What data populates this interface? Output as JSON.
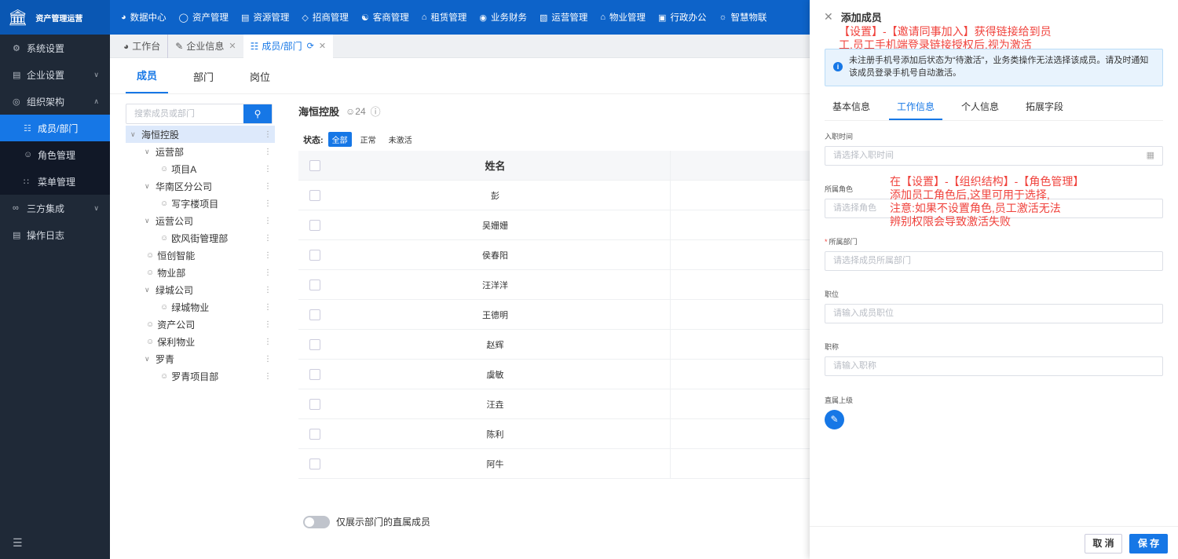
{
  "app": {
    "title": "资产管理运营"
  },
  "topnav": [
    {
      "label": "数据中心",
      "icon": "dashboard-icon"
    },
    {
      "label": "资产管理",
      "icon": "cube-icon"
    },
    {
      "label": "资源管理",
      "icon": "building-icon"
    },
    {
      "label": "招商管理",
      "icon": "tag-icon"
    },
    {
      "label": "客商管理",
      "icon": "users-icon"
    },
    {
      "label": "租赁管理",
      "icon": "house-icon"
    },
    {
      "label": "业务财务",
      "icon": "coin-icon"
    },
    {
      "label": "运营管理",
      "icon": "chart-icon"
    },
    {
      "label": "物业管理",
      "icon": "home-icon"
    },
    {
      "label": "行政办公",
      "icon": "monitor-icon"
    },
    {
      "label": "智慧物联",
      "icon": "sun-icon"
    }
  ],
  "sidebar": {
    "items": [
      {
        "label": "系统设置"
      },
      {
        "label": "企业设置"
      },
      {
        "label": "组织架构"
      },
      {
        "label": "成员/部门"
      },
      {
        "label": "角色管理"
      },
      {
        "label": "菜单管理"
      },
      {
        "label": "三方集成"
      },
      {
        "label": "操作日志"
      }
    ]
  },
  "tabs": [
    {
      "label": "工作台"
    },
    {
      "label": "企业信息"
    },
    {
      "label": "成员/部门"
    }
  ],
  "subtabs": [
    "成员",
    "部门",
    "岗位"
  ],
  "search": {
    "placeholder": "搜索成员或部门"
  },
  "tree": [
    "海恒控股",
    "运营部",
    "项目A",
    "华南区分公司",
    "写字楼项目",
    "运营公司",
    "欧风街管理部",
    "恒创智能",
    "物业部",
    "绿城公司",
    "绿城物业",
    "资产公司",
    "保利物业",
    "罗青",
    "罗青项目部"
  ],
  "org": {
    "name": "海恒控股",
    "count": "24"
  },
  "status": {
    "label": "状态:",
    "chips": [
      "全部",
      "正常",
      "未激活"
    ]
  },
  "table": {
    "header": "姓名",
    "rows": [
      "彭",
      "吴姗姗",
      "侯春阳",
      "汪洋洋",
      "王德明",
      "赵辉",
      "虞敏",
      "汪垚",
      "陈利",
      "阿牛"
    ]
  },
  "toggle": {
    "label": "仅展示部门的直属成员"
  },
  "drawer": {
    "title": "添加成员",
    "annotation1": [
      "【设置】-【邀请同事加入】获得链接给到员",
      "工,员工手机端登录链接授权后,视为激活"
    ],
    "info": [
      "未注册手机号添加后状态为“待激活”，业务类操作无法选择该成员。请及时通知",
      "该成员登录手机号自动激活。"
    ],
    "tabs": [
      "基本信息",
      "工作信息",
      "个人信息",
      "拓展字段"
    ],
    "fields": {
      "entry_date": {
        "label": "入职时间",
        "placeholder": "请选择入职时间"
      },
      "role": {
        "label": "所属角色",
        "placeholder": "请选择角色"
      },
      "dept": {
        "label": "所属部门",
        "placeholder": "请选择成员所属部门"
      },
      "position": {
        "label": "职位",
        "placeholder": "请输入成员职位"
      },
      "title": {
        "label": "职称",
        "placeholder": "请输入职称"
      },
      "superior": {
        "label": "直属上级"
      }
    },
    "annotation2": [
      "在【设置】-【组织结构】-【角色管理】",
      "添加员工角色后,这里可用于选择,",
      "注意:如果不设置角色,员工激活无法",
      "辨别权限会导致激活失败"
    ],
    "cancel": "取 消",
    "save": "保 存"
  }
}
